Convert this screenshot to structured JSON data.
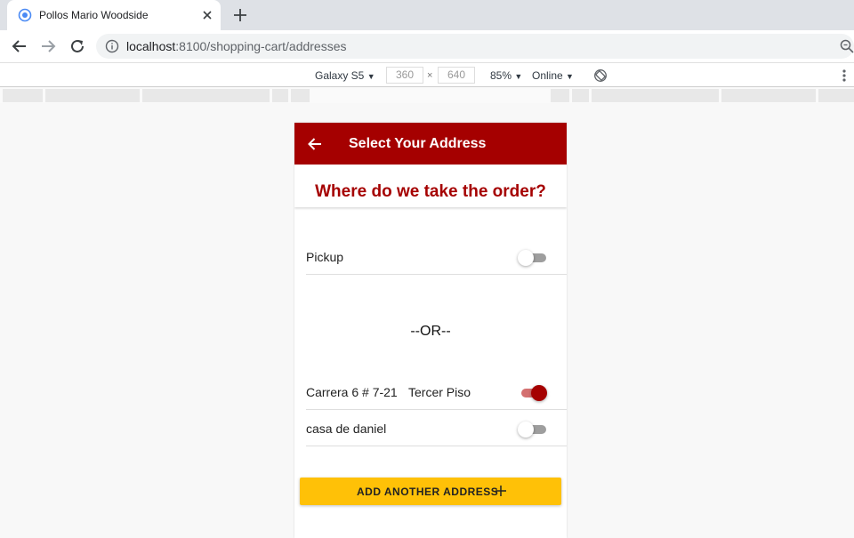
{
  "browser": {
    "tab_title": "Pollos Mario Woodside",
    "url_host": "localhost",
    "url_rest": ":8100/shopping-cart/addresses",
    "icons": {
      "favicon": "ionic-icon",
      "close": "close-icon",
      "new_tab": "plus-icon",
      "back": "arrow-left-icon",
      "forward": "arrow-right-icon",
      "reload": "reload-icon",
      "site_info": "info-icon",
      "zoom": "zoom-icon"
    }
  },
  "device_toolbar": {
    "device": "Galaxy S5",
    "width": "360",
    "height": "640",
    "times": "×",
    "zoom": "85%",
    "network": "Online",
    "dropdown_arrow": "▼"
  },
  "app": {
    "header_title": "Select Your Address",
    "subheader_title": "Where do we take the order?",
    "pickup": {
      "label": "Pickup",
      "checked": false
    },
    "or_text": "--OR--",
    "addresses": [
      {
        "label": "Carrera 6 # 7-21",
        "note": "Tercer Piso",
        "checked": true
      },
      {
        "label": "casa de daniel",
        "note": "",
        "checked": false
      }
    ],
    "add_button_label": "ADD ANOTHER ADDRESS"
  },
  "colors": {
    "primary": "#a50000",
    "accent": "#ffc107",
    "toggle_on_track": "#d47070",
    "toggle_off_track": "#9e9e9e"
  }
}
